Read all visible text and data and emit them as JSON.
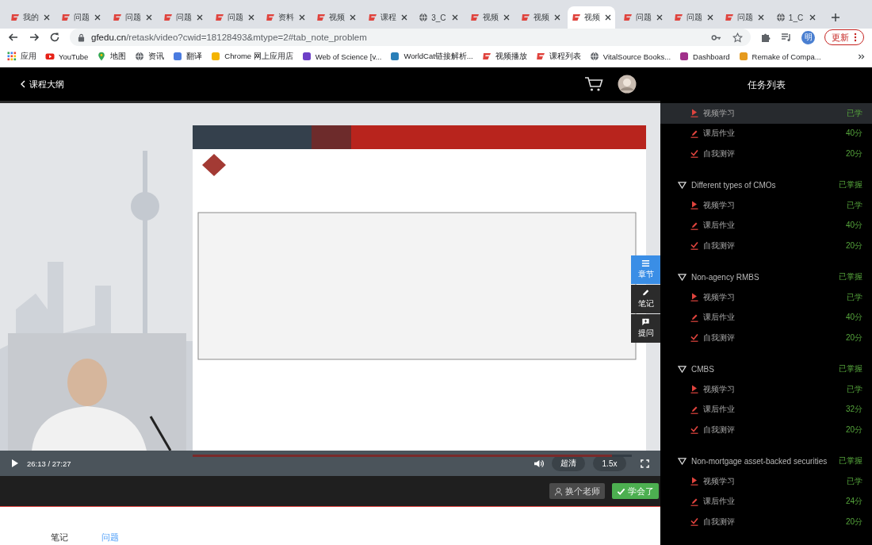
{
  "browser": {
    "tabs": [
      {
        "kind": "gf",
        "title": "我的",
        "selected": false
      },
      {
        "kind": "gf",
        "title": "问题",
        "selected": false
      },
      {
        "kind": "gf",
        "title": "问题",
        "selected": false
      },
      {
        "kind": "gf",
        "title": "问题",
        "selected": false
      },
      {
        "kind": "gf",
        "title": "问题",
        "selected": false
      },
      {
        "kind": "gf",
        "title": "资料",
        "selected": false
      },
      {
        "kind": "gf",
        "title": "视频",
        "selected": false
      },
      {
        "kind": "gf",
        "title": "课程",
        "selected": false
      },
      {
        "kind": "globe",
        "title": "3_C",
        "selected": false
      },
      {
        "kind": "gf",
        "title": "视频",
        "selected": false
      },
      {
        "kind": "gf",
        "title": "视频",
        "selected": false
      },
      {
        "kind": "gf",
        "title": "视频",
        "selected": true
      },
      {
        "kind": "gf",
        "title": "问题",
        "selected": false
      },
      {
        "kind": "gf",
        "title": "问题",
        "selected": false
      },
      {
        "kind": "gf",
        "title": "问题",
        "selected": false
      },
      {
        "kind": "globe",
        "title": "1_C",
        "selected": false
      }
    ],
    "address": {
      "host": "gfedu.cn",
      "path": "/retask/video?cwid=18128493&mtype=2#tab_note_problem"
    },
    "profile": "明",
    "update_button": "更新",
    "bookmarks": [
      {
        "kind": "apps",
        "label": "应用"
      },
      {
        "kind": "youtube",
        "label": "YouTube"
      },
      {
        "kind": "pin",
        "label": "地图"
      },
      {
        "kind": "globe",
        "label": "资讯"
      },
      {
        "kind": "translate",
        "label": "翻译"
      },
      {
        "kind": "store",
        "label": "Chrome 网上应用店"
      },
      {
        "kind": "wos",
        "label": "Web of Science [v..."
      },
      {
        "kind": "worldcat",
        "label": "WorldCat链接解析..."
      },
      {
        "kind": "gf",
        "label": "视频播放"
      },
      {
        "kind": "gf",
        "label": "课程列表"
      },
      {
        "kind": "globe",
        "label": "VitalSource Books..."
      },
      {
        "kind": "dashboard",
        "label": "Dashboard"
      },
      {
        "kind": "flower",
        "label": "Remake of Compa..."
      }
    ]
  },
  "header": {
    "back": "课程大纲"
  },
  "player": {
    "time": "26:13 / 27:27",
    "level": 0.955,
    "quality": "超清",
    "speed": "1.5x",
    "side_buttons": [
      {
        "kind": "menu",
        "label": "章节",
        "selected": true
      },
      {
        "kind": "pencil",
        "label": "笔记",
        "selected": false
      },
      {
        "kind": "comment",
        "label": "提问",
        "selected": false
      }
    ]
  },
  "actions": [
    {
      "kind": "teacher",
      "label": "换个老师"
    },
    {
      "kind": "done",
      "label": "学会了"
    }
  ],
  "bottom_tabs": [
    {
      "label": "笔记",
      "selected": false
    },
    {
      "label": "问题",
      "selected": true
    }
  ],
  "task_list": {
    "title": "任务列表",
    "groups": [
      {
        "items": [
          {
            "kind": "video",
            "label": "视频学习",
            "status": "已学",
            "selected": true
          },
          {
            "kind": "homework",
            "label": "课后作业",
            "status": "40分",
            "selected": false
          },
          {
            "kind": "test",
            "label": "自我测评",
            "status": "20分",
            "selected": false
          }
        ]
      },
      {
        "title": "Different types of CMOs",
        "status": "已掌握",
        "expanded": true,
        "items": [
          {
            "kind": "video",
            "label": "视频学习",
            "status": "已学",
            "selected": false
          },
          {
            "kind": "homework",
            "label": "课后作业",
            "status": "40分",
            "selected": false
          },
          {
            "kind": "test",
            "label": "自我测评",
            "status": "20分",
            "selected": false
          }
        ]
      },
      {
        "title": "Non-agency RMBS",
        "status": "已掌握",
        "expanded": true,
        "items": [
          {
            "kind": "video",
            "label": "视频学习",
            "status": "已学",
            "selected": false
          },
          {
            "kind": "homework",
            "label": "课后作业",
            "status": "40分",
            "selected": false
          },
          {
            "kind": "test",
            "label": "自我测评",
            "status": "20分",
            "selected": false
          }
        ]
      },
      {
        "title": "CMBS",
        "status": "已掌握",
        "expanded": true,
        "items": [
          {
            "kind": "video",
            "label": "视频学习",
            "status": "已学",
            "selected": false
          },
          {
            "kind": "homework",
            "label": "课后作业",
            "status": "32分",
            "selected": false
          },
          {
            "kind": "test",
            "label": "自我测评",
            "status": "20分",
            "selected": false
          }
        ]
      },
      {
        "title": "Non-mortgage asset-backed securities",
        "status": "已掌握",
        "expanded": true,
        "items": [
          {
            "kind": "video",
            "label": "视频学习",
            "status": "已学",
            "selected": false
          },
          {
            "kind": "homework",
            "label": "课后作业",
            "status": "24分",
            "selected": false
          },
          {
            "kind": "test",
            "label": "自我测评",
            "status": "20分",
            "selected": false
          }
        ]
      }
    ]
  }
}
